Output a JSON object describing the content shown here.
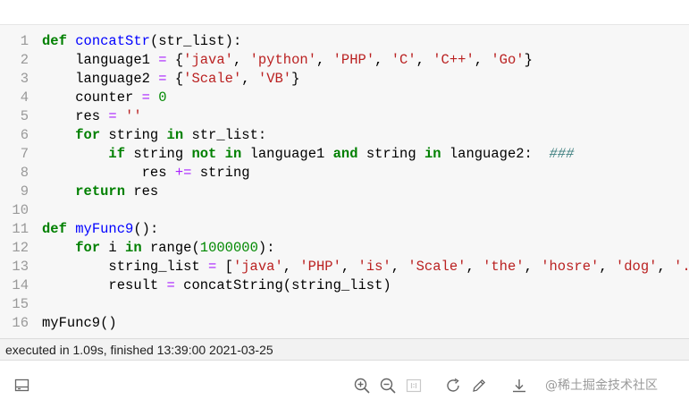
{
  "editor": {
    "lines": [
      {
        "num": "1",
        "tokens": [
          {
            "t": "kw",
            "v": "def"
          },
          {
            "t": "p",
            "v": " "
          },
          {
            "t": "fn",
            "v": "concatStr"
          },
          {
            "t": "p",
            "v": "(str_list):"
          }
        ]
      },
      {
        "num": "2",
        "tokens": [
          {
            "t": "p",
            "v": "    language1 "
          },
          {
            "t": "op",
            "v": "="
          },
          {
            "t": "p",
            "v": " {"
          },
          {
            "t": "str",
            "v": "'java'"
          },
          {
            "t": "p",
            "v": ", "
          },
          {
            "t": "str",
            "v": "'python'"
          },
          {
            "t": "p",
            "v": ", "
          },
          {
            "t": "str",
            "v": "'PHP'"
          },
          {
            "t": "p",
            "v": ", "
          },
          {
            "t": "str",
            "v": "'C'"
          },
          {
            "t": "p",
            "v": ", "
          },
          {
            "t": "str",
            "v": "'C++'"
          },
          {
            "t": "p",
            "v": ", "
          },
          {
            "t": "str",
            "v": "'Go'"
          },
          {
            "t": "p",
            "v": "}"
          }
        ]
      },
      {
        "num": "3",
        "tokens": [
          {
            "t": "p",
            "v": "    language2 "
          },
          {
            "t": "op",
            "v": "="
          },
          {
            "t": "p",
            "v": " {"
          },
          {
            "t": "str",
            "v": "'Scale'"
          },
          {
            "t": "p",
            "v": ", "
          },
          {
            "t": "str",
            "v": "'VB'"
          },
          {
            "t": "p",
            "v": "}"
          }
        ]
      },
      {
        "num": "4",
        "tokens": [
          {
            "t": "p",
            "v": "    counter "
          },
          {
            "t": "op",
            "v": "="
          },
          {
            "t": "p",
            "v": " "
          },
          {
            "t": "num",
            "v": "0"
          }
        ]
      },
      {
        "num": "5",
        "tokens": [
          {
            "t": "p",
            "v": "    res "
          },
          {
            "t": "op",
            "v": "="
          },
          {
            "t": "p",
            "v": " "
          },
          {
            "t": "str",
            "v": "''"
          }
        ]
      },
      {
        "num": "6",
        "tokens": [
          {
            "t": "p",
            "v": "    "
          },
          {
            "t": "kw",
            "v": "for"
          },
          {
            "t": "p",
            "v": " string "
          },
          {
            "t": "kw",
            "v": "in"
          },
          {
            "t": "p",
            "v": " str_list:"
          }
        ]
      },
      {
        "num": "7",
        "tokens": [
          {
            "t": "p",
            "v": "        "
          },
          {
            "t": "kw",
            "v": "if"
          },
          {
            "t": "p",
            "v": " string "
          },
          {
            "t": "kw",
            "v": "not"
          },
          {
            "t": "p",
            "v": " "
          },
          {
            "t": "kw",
            "v": "in"
          },
          {
            "t": "p",
            "v": " language1 "
          },
          {
            "t": "kw",
            "v": "and"
          },
          {
            "t": "p",
            "v": " string "
          },
          {
            "t": "kw",
            "v": "in"
          },
          {
            "t": "p",
            "v": " language2:  "
          },
          {
            "t": "cm",
            "v": "###"
          }
        ]
      },
      {
        "num": "8",
        "tokens": [
          {
            "t": "p",
            "v": "            res "
          },
          {
            "t": "op",
            "v": "+="
          },
          {
            "t": "p",
            "v": " string"
          }
        ]
      },
      {
        "num": "9",
        "tokens": [
          {
            "t": "p",
            "v": "    "
          },
          {
            "t": "kw",
            "v": "return"
          },
          {
            "t": "p",
            "v": " res"
          }
        ]
      },
      {
        "num": "10",
        "tokens": []
      },
      {
        "num": "11",
        "tokens": [
          {
            "t": "kw",
            "v": "def"
          },
          {
            "t": "p",
            "v": " "
          },
          {
            "t": "fn",
            "v": "myFunc9"
          },
          {
            "t": "p",
            "v": "():"
          }
        ]
      },
      {
        "num": "12",
        "tokens": [
          {
            "t": "p",
            "v": "    "
          },
          {
            "t": "kw",
            "v": "for"
          },
          {
            "t": "p",
            "v": " i "
          },
          {
            "t": "kw",
            "v": "in"
          },
          {
            "t": "p",
            "v": " range("
          },
          {
            "t": "num",
            "v": "1000000"
          },
          {
            "t": "p",
            "v": "):"
          }
        ]
      },
      {
        "num": "13",
        "tokens": [
          {
            "t": "p",
            "v": "        string_list "
          },
          {
            "t": "op",
            "v": "="
          },
          {
            "t": "p",
            "v": " ["
          },
          {
            "t": "str",
            "v": "'java'"
          },
          {
            "t": "p",
            "v": ", "
          },
          {
            "t": "str",
            "v": "'PHP'"
          },
          {
            "t": "p",
            "v": ", "
          },
          {
            "t": "str",
            "v": "'is'"
          },
          {
            "t": "p",
            "v": ", "
          },
          {
            "t": "str",
            "v": "'Scale'"
          },
          {
            "t": "p",
            "v": ", "
          },
          {
            "t": "str",
            "v": "'the'"
          },
          {
            "t": "p",
            "v": ", "
          },
          {
            "t": "str",
            "v": "'hosre'"
          },
          {
            "t": "p",
            "v": ", "
          },
          {
            "t": "str",
            "v": "'dog'"
          },
          {
            "t": "p",
            "v": ", "
          },
          {
            "t": "str",
            "v": "'.'"
          },
          {
            "t": "p",
            "v": "]"
          }
        ]
      },
      {
        "num": "14",
        "tokens": [
          {
            "t": "p",
            "v": "        result "
          },
          {
            "t": "op",
            "v": "="
          },
          {
            "t": "p",
            "v": " concatString(string_list)"
          }
        ]
      },
      {
        "num": "15",
        "tokens": []
      },
      {
        "num": "16",
        "tokens": [
          {
            "t": "p",
            "v": "myFunc9()"
          }
        ]
      }
    ]
  },
  "status": {
    "text": "executed in 1.09s, finished 13:39:00 2021-03-25"
  },
  "toolbar": {
    "watermark": "@稀土掘金技术社区",
    "icons": [
      "panel-toggle-icon",
      "zoom-in-icon",
      "zoom-out-icon",
      "actual-size-icon",
      "refresh-icon",
      "edit-pencil-icon",
      "download-icon"
    ]
  },
  "colors": {
    "editor_bg": "#f7f7f7",
    "keyword": "#008000",
    "function": "#0000ff",
    "string": "#ba2121",
    "number": "#008800",
    "operator": "#aa22ff",
    "comment": "#408080",
    "line_number": "#999999"
  }
}
